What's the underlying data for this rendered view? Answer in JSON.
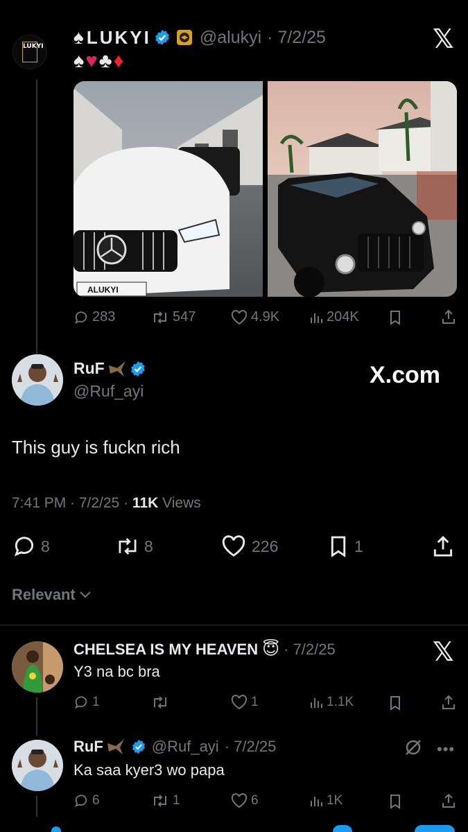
{
  "quoted": {
    "name": "LUKYI",
    "handle": "@alukyi",
    "date": "· 7/2/25",
    "suits": "♠♥♣♦",
    "avatar_text": "LUKYI",
    "plate_text": "ALUKYI",
    "actions": {
      "replies": "283",
      "reposts": "547",
      "likes": "4.9K",
      "views": "204K"
    }
  },
  "main": {
    "name": "RuF",
    "handle": "@Ruf_ayi",
    "watermark": "X.com",
    "body": "This guy is fuckn rich",
    "time": "7:41 PM · 7/2/25 · ",
    "views_count": "11K",
    "views_label": " Views",
    "actions": {
      "replies": "8",
      "reposts": "8",
      "likes": "226",
      "bookmarks": "1"
    }
  },
  "sort": {
    "label": "Relevant"
  },
  "replies": [
    {
      "name": "CHELSEA IS MY HEAVEN",
      "emoji": "😇",
      "date": "· 7/2/25",
      "body": "Y3 na bc bra",
      "actions": {
        "replies": "1",
        "reposts": "",
        "likes": "1",
        "views": "1.1K"
      }
    },
    {
      "name": "RuF",
      "handle": "@Ruf_ayi",
      "date": "· 7/2/25",
      "body": "Ka saa kyer3 wo papa",
      "actions": {
        "replies": "6",
        "reposts": "1",
        "likes": "6",
        "views": "1K"
      }
    }
  ],
  "colors": {
    "background": "#000000",
    "text": "#e7e9ea",
    "muted": "#71767b",
    "verified": "#1d9bf0",
    "heart_suit": "#e0245e",
    "diamond_suit": "#f4212e"
  }
}
